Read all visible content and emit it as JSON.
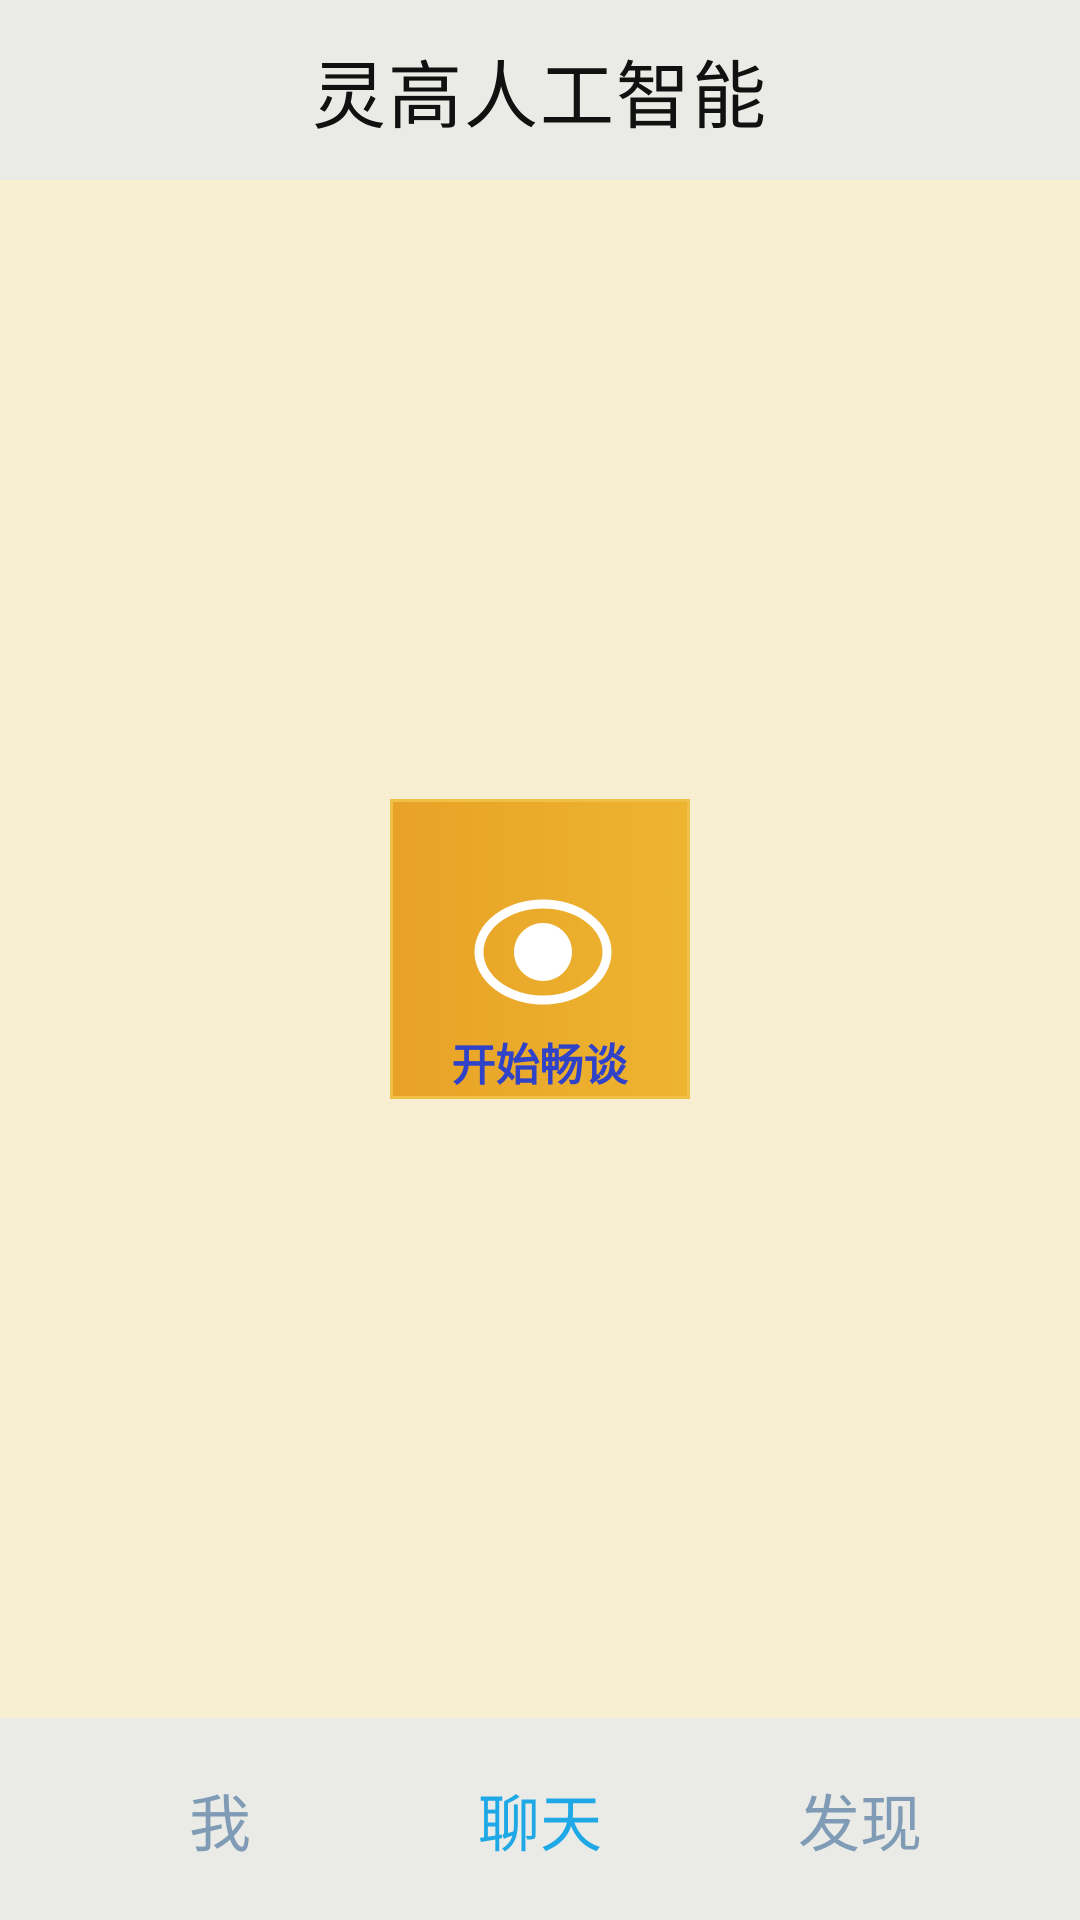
{
  "header": {
    "title": "灵高人工智能"
  },
  "main": {
    "start_chat": {
      "label": "开始畅谈",
      "icon": "eye-icon"
    }
  },
  "bottom_nav": {
    "items": [
      {
        "label": "我",
        "active": false
      },
      {
        "label": "聊天",
        "active": true
      },
      {
        "label": "发现",
        "active": false
      }
    ]
  },
  "colors": {
    "background": "#f8eed2",
    "bars": "#eaeae6",
    "tile_start": "#e8a227",
    "tile_end": "#edb430",
    "tile_label": "#2f42c8",
    "nav_active": "#1fa8e6",
    "nav_inactive": "#7f9bb5",
    "title": "#111111"
  }
}
